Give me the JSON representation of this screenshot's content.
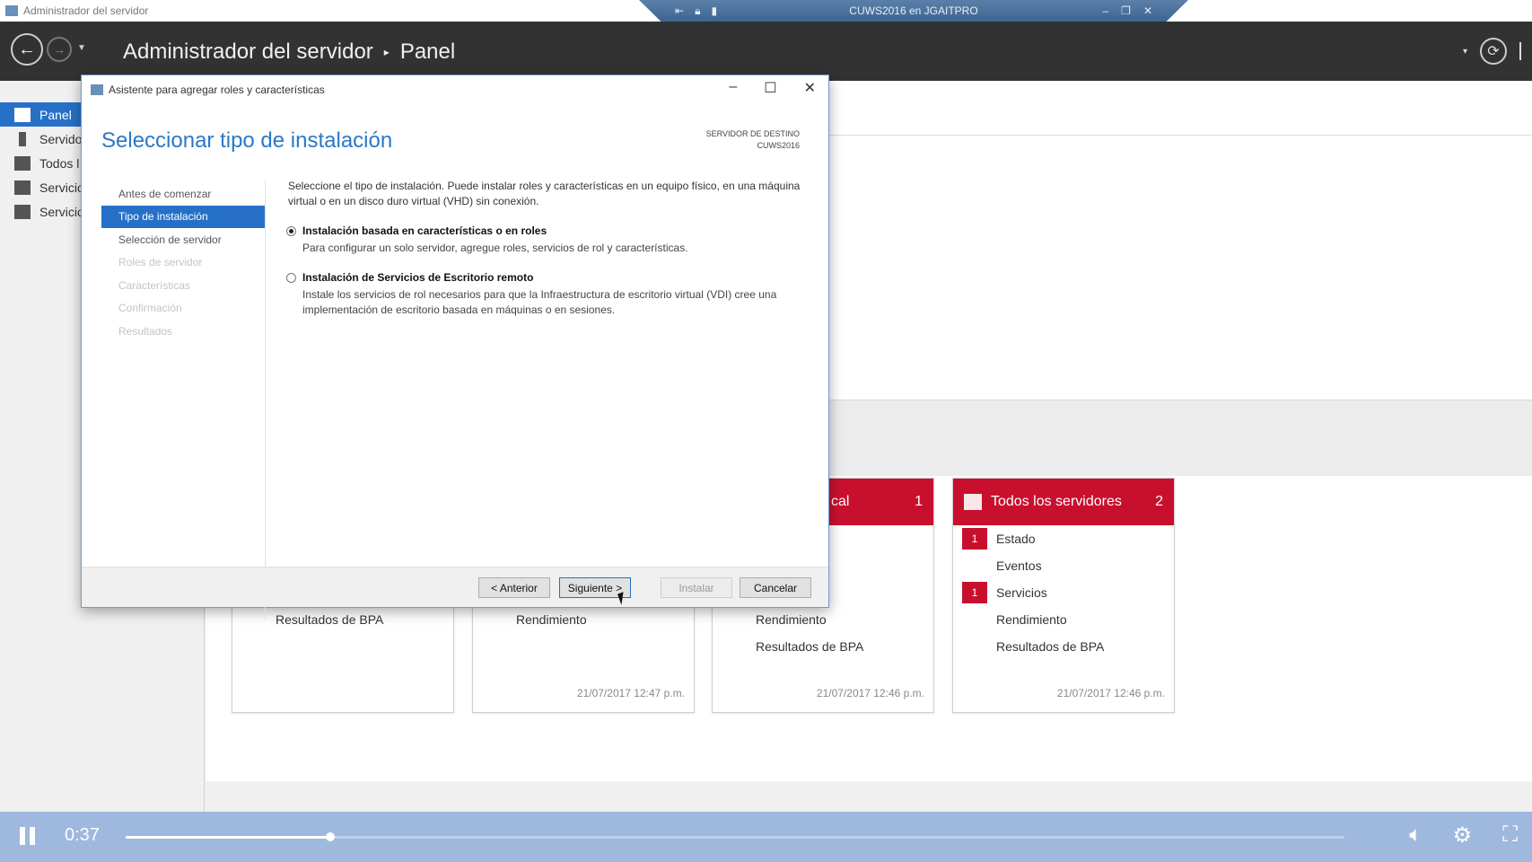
{
  "window": {
    "app_title": "Administrador del servidor",
    "rdp_title": "CUWS2016 en JGAITPRO"
  },
  "header": {
    "breadcrumb_root": "Administrador del servidor",
    "breadcrumb_sep": "▸",
    "breadcrumb_page": "Panel"
  },
  "sidebar": {
    "items": [
      {
        "label": "Panel",
        "icon": "dashboard-icon",
        "active": true
      },
      {
        "label": "Servido",
        "icon": "server-icon"
      },
      {
        "label": "Todos l",
        "icon": "all-servers-icon"
      },
      {
        "label": "Servicio",
        "icon": "file-services-icon"
      },
      {
        "label": "Servicio",
        "icon": "print-services-icon"
      }
    ]
  },
  "tiles": [
    {
      "title": "",
      "count": "",
      "rows": [
        {
          "badge": "",
          "label": ""
        },
        {
          "badge": "",
          "label": ""
        },
        {
          "badge": "",
          "label": ""
        },
        {
          "badge": "",
          "label": ""
        },
        {
          "badge": "",
          "label": "Resultados de BPA"
        }
      ],
      "timestamp": ""
    },
    {
      "title": "",
      "count": "",
      "rows": [
        {
          "badge": "",
          "label": ""
        },
        {
          "badge": "",
          "label": ""
        },
        {
          "badge": "",
          "label": ""
        },
        {
          "badge": "",
          "label": "Rendimiento"
        }
      ],
      "timestamp": "21/07/2017 12:47 p.m."
    },
    {
      "title": "cal",
      "count": "1",
      "rows": [
        {
          "badge": "",
          "label": ""
        },
        {
          "badge": "",
          "label": ""
        },
        {
          "badge": "",
          "label": ""
        },
        {
          "badge": "",
          "label": "Rendimiento"
        },
        {
          "badge": "",
          "label": "Resultados de BPA"
        }
      ],
      "timestamp": "21/07/2017 12:46 p.m."
    },
    {
      "title": "Todos los servidores",
      "count": "2",
      "rows": [
        {
          "badge": "1",
          "label": "Estado"
        },
        {
          "badge": "",
          "label": "Eventos"
        },
        {
          "badge": "1",
          "label": "Servicios"
        },
        {
          "badge": "",
          "label": "Rendimiento"
        },
        {
          "badge": "",
          "label": "Resultados de BPA"
        }
      ],
      "timestamp": "21/07/2017 12:46 p.m."
    }
  ],
  "dialog": {
    "title": "Asistente para agregar roles y características",
    "heading": "Seleccionar tipo de instalación",
    "dest_label": "SERVIDOR DE DESTINO",
    "dest_server": "CUWS2016",
    "steps": [
      {
        "label": "Antes de comenzar",
        "state": "normal"
      },
      {
        "label": "Tipo de instalación",
        "state": "active"
      },
      {
        "label": "Selección de servidor",
        "state": "normal"
      },
      {
        "label": "Roles de servidor",
        "state": "disabled"
      },
      {
        "label": "Características",
        "state": "disabled"
      },
      {
        "label": "Confirmación",
        "state": "disabled"
      },
      {
        "label": "Resultados",
        "state": "disabled"
      }
    ],
    "intro": "Seleccione el tipo de instalación. Puede instalar roles y características en un equipo físico, en una máquina virtual o en un disco duro virtual (VHD) sin conexión.",
    "options": [
      {
        "title": "Instalación basada en características o en roles",
        "desc": "Para configurar un solo servidor, agregue roles, servicios de rol y características.",
        "selected": true
      },
      {
        "title": "Instalación de Servicios de Escritorio remoto",
        "desc": "Instale los servicios de rol necesarios para que la Infraestructura de escritorio virtual (VDI) cree una implementación de escritorio basada en máquinas o en sesiones.",
        "selected": false
      }
    ],
    "buttons": {
      "prev": "< Anterior",
      "next": "Siguiente >",
      "install": "Instalar",
      "cancel": "Cancelar"
    }
  },
  "player": {
    "time": "0:37",
    "progress": 0.168
  },
  "colors": {
    "accent": "#2670c8",
    "tile_red": "#c8102e",
    "header_dark": "#323232"
  }
}
